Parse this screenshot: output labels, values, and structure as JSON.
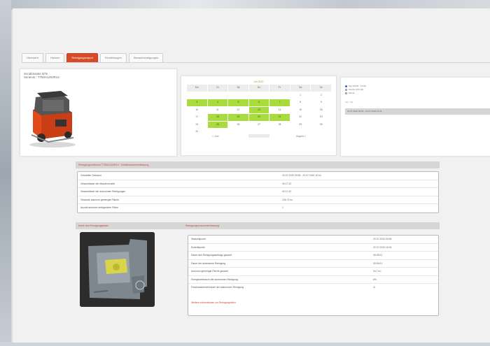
{
  "tabs": [
    {
      "label": "Übersicht",
      "active": false
    },
    {
      "label": "Historie",
      "active": false
    },
    {
      "label": "Reinigungsreport",
      "active": true
    },
    {
      "label": "Einstellungen",
      "active": false
    },
    {
      "label": "Benachrichtigungen",
      "active": false
    }
  ],
  "machine": {
    "name": "Scrubmaster B75",
    "serial": "Seriennr.: T750A1204R14"
  },
  "calendar": {
    "title": "Juli 2020",
    "headers": [
      "Mo",
      "Di",
      "Mi",
      "Do",
      "Fr",
      "Sa",
      "So"
    ],
    "days": [
      {
        "d": "",
        "hl": false
      },
      {
        "d": "",
        "hl": false
      },
      {
        "d": "",
        "hl": false
      },
      {
        "d": "",
        "hl": false
      },
      {
        "d": "",
        "hl": false
      },
      {
        "d": "1",
        "hl": false
      },
      {
        "d": "2",
        "hl": false
      },
      {
        "d": "3",
        "hl": true
      },
      {
        "d": "4",
        "hl": true
      },
      {
        "d": "5",
        "hl": true
      },
      {
        "d": "6",
        "hl": true
      },
      {
        "d": "7",
        "hl": true
      },
      {
        "d": "8",
        "hl": false
      },
      {
        "d": "9",
        "hl": false
      },
      {
        "d": "10",
        "hl": false
      },
      {
        "d": "11",
        "hl": false
      },
      {
        "d": "12",
        "hl": false
      },
      {
        "d": "13",
        "hl": true
      },
      {
        "d": "14",
        "hl": false
      },
      {
        "d": "15",
        "hl": false
      },
      {
        "d": "16",
        "hl": false
      },
      {
        "d": "17",
        "hl": false
      },
      {
        "d": "18",
        "hl": true
      },
      {
        "d": "19",
        "hl": true
      },
      {
        "d": "20",
        "hl": true
      },
      {
        "d": "21",
        "hl": true
      },
      {
        "d": "22",
        "hl": false
      },
      {
        "d": "23",
        "hl": false
      },
      {
        "d": "24",
        "hl": false
      },
      {
        "d": "25",
        "hl": true
      },
      {
        "d": "26",
        "hl": false
      },
      {
        "d": "27",
        "hl": false
      },
      {
        "d": "28",
        "hl": false
      },
      {
        "d": "29",
        "hl": false
      },
      {
        "d": "30",
        "hl": false
      },
      {
        "d": "31",
        "hl": false
      },
      {
        "d": "",
        "hl": false
      },
      {
        "d": "",
        "hl": false
      },
      {
        "d": "",
        "hl": false
      },
      {
        "d": "",
        "hl": false
      },
      {
        "d": "",
        "hl": false
      },
      {
        "d": "",
        "hl": false
      }
    ],
    "prev": "< Juni",
    "next": "August >"
  },
  "range": {
    "options": [
      {
        "label": "Tag (09:59 - 10:04)",
        "selected": true
      },
      {
        "label": "Woche (KW 29)",
        "selected": false
      },
      {
        "label": "Monat",
        "selected": false
      }
    ],
    "label": "von - bis",
    "value": "20.07.2020 09:59 - 20.07.2020 10:04"
  },
  "section1": {
    "title": "Reinigungszeitraum T750A1204R14 - Detailzusammenfassung",
    "rows": [
      {
        "key": "Gewählter Zeitraum",
        "value": "20.07.2020 09:59 - 20.07.2020 10:04"
      },
      {
        "key": "Gesamtdauer der Maschinenzeit",
        "value": "00:17:42"
      },
      {
        "key": "Gesamtdauer der autonomen Reinigungen",
        "value": "00:17:42"
      },
      {
        "key": "Gesamte autonom gereinigte Fläche",
        "value": "126,73 m²"
      },
      {
        "key": "Anzahl autonom erfolgreicher Pläne",
        "value": "1"
      }
    ]
  },
  "section2": {
    "title": "Karte des Reinigungsplans",
    "title_b": "Reinigungszusammenfassung",
    "rows": [
      {
        "key": "Startzeitpunkt",
        "value": "20.07.2020 09:59"
      },
      {
        "key": "Endzeitpunkt",
        "value": "20.07.2020 10:04"
      },
      {
        "key": "Dauer des Reinigungsauftrags gesamt",
        "value": "00:05:01"
      },
      {
        "key": "Dauer der autonomen Reinigung",
        "value": "00:05:01"
      },
      {
        "key": "Autonom gereinigte Fläche gesamt",
        "value": "34,7 m²"
      },
      {
        "key": "Energieverbrauch der autonomen Reinigung",
        "value": "6%"
      },
      {
        "key": "Frischwasserverbrauch der autonomen Reinigung",
        "value": "4l"
      }
    ],
    "warning": "Weitere Informationen zur Reinigungsfahrt"
  }
}
